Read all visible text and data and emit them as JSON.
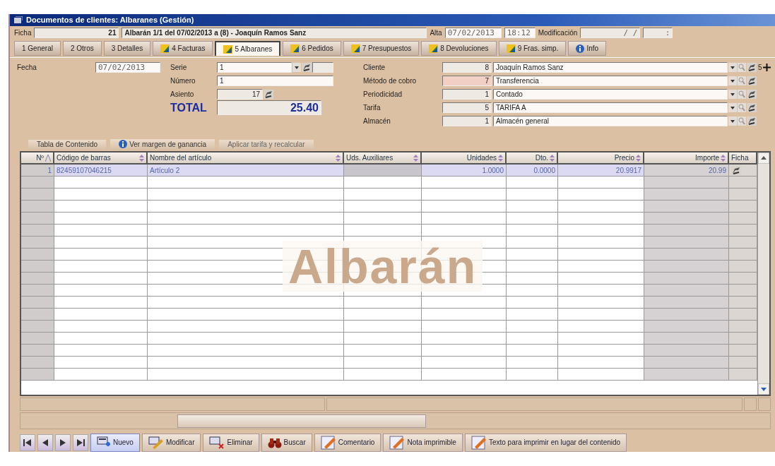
{
  "window": {
    "title": "Documentos de clientes: Albaranes (Gestión)"
  },
  "header": {
    "ficha_label": "Ficha",
    "ficha_number": "21",
    "ficha_description": "Albarán 1/1 del 07/02/2013 a (8) - Joaquín Ramos Sanz",
    "alta_label": "Alta",
    "alta_date": "07/02/2013",
    "alta_time": "18:12",
    "modificacion_label": "Modificación",
    "modificacion_date": "/ /",
    "modificacion_time": ":"
  },
  "tabs": [
    {
      "label": "1 General",
      "kind": "plain",
      "selected": false
    },
    {
      "label": "2 Otros",
      "kind": "plain",
      "selected": false
    },
    {
      "label": "3 Detalles",
      "kind": "plain",
      "selected": false
    },
    {
      "label": "4 Facturas",
      "kind": "document",
      "selected": false
    },
    {
      "label": "5 Albaranes",
      "kind": "document",
      "selected": true
    },
    {
      "label": "6 Pedidos",
      "kind": "document",
      "selected": false
    },
    {
      "label": "7 Presupuestos",
      "kind": "document",
      "selected": false
    },
    {
      "label": "8 Devoluciones",
      "kind": "document",
      "selected": false
    },
    {
      "label": "9 Fras. simp.",
      "kind": "document",
      "selected": false
    },
    {
      "label": "Info",
      "kind": "info",
      "selected": false
    }
  ],
  "form_left": {
    "fecha_label": "Fecha",
    "fecha_value": "07/02/2013",
    "serie_label": "Serie",
    "serie_value": "1",
    "numero_label": "Número",
    "numero_value": "1",
    "asiento_label": "Asiento",
    "asiento_value": "17",
    "total_label": "TOTAL",
    "total_value": "25.40"
  },
  "form_right": [
    {
      "label": "Cliente",
      "code": "8",
      "value": "Joaquín Ramos Sanz",
      "highlighted": false
    },
    {
      "label": "Método de cobro",
      "code": "7",
      "value": "Transferencia",
      "highlighted": true
    },
    {
      "label": "Periodicidad",
      "code": "1",
      "value": "Contado",
      "highlighted": false
    },
    {
      "label": "Tarifa",
      "code": "5",
      "value": "TARIFA A",
      "highlighted": false
    },
    {
      "label": "Almacén",
      "code": "1",
      "value": "Almacén general",
      "highlighted": false
    }
  ],
  "cliente_extra": "5",
  "links": [
    {
      "label": "Tabla de Contenido",
      "kind": "plain"
    },
    {
      "label": "Ver margen de ganancia",
      "kind": "info"
    },
    {
      "label": "Aplicar tarifa y recalcular",
      "kind": "plain"
    }
  ],
  "table": {
    "columns": [
      "Nº",
      "Código de barras",
      "Nombre del artículo",
      "Uds. Auxiliares",
      "Unidades",
      "Dto.",
      "Precio",
      "Importe",
      "Ficha"
    ],
    "rows": [
      {
        "number": "1",
        "barcode": "82459107046215",
        "name": "Artículo 2",
        "units": "1.0000",
        "discount": "0.0000",
        "price": "20.9917",
        "amount": "20.99",
        "selected": true
      }
    ],
    "background_label": "Albarán"
  },
  "buttons": [
    {
      "label": "Nuevo",
      "kind": "new",
      "selected": true
    },
    {
      "label": "Modificar",
      "kind": "edit",
      "selected": false
    },
    {
      "label": "Eliminar",
      "kind": "delete",
      "selected": false
    },
    {
      "label": "Buscar",
      "kind": "search",
      "selected": false
    },
    {
      "label": "Comentario",
      "kind": "note",
      "selected": false
    },
    {
      "label": "Nota imprimible",
      "kind": "note",
      "selected": false
    },
    {
      "label": "Texto para imprimir en lugar del contenido",
      "kind": "note",
      "selected": false
    }
  ]
}
